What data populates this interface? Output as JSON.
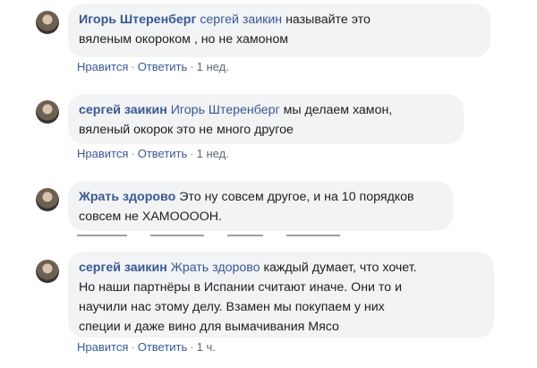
{
  "comments": [
    {
      "author": "Игорь Штеренберг",
      "mention": "сергей заикин",
      "text_line1": "называйте это",
      "text_line2": "вяленым окороком , но не хамоном",
      "like_label": "Нравится",
      "reply_label": "Ответить",
      "time": "1 нед."
    },
    {
      "author": "сергей заикин",
      "mention": "Игорь Штеренберг",
      "text_line1": "мы делаем хамон,",
      "text_line2": "вяленый окорок это не много другое",
      "like_label": "Нравится",
      "reply_label": "Ответить",
      "time": "1 нед."
    },
    {
      "author": "Жрать здорово",
      "text_line1": "Это ну совсем другое, и на 10 порядков",
      "text_line2": "совсем не ХАМООООН."
    },
    {
      "author": "сергей заикин",
      "mention": "Жрать здорово",
      "text_line1": "каждый думает, что хочет.",
      "text_line2": "Но наши партнёры в Испании считают иначе. Они то и",
      "text_line3": "научили нас этому делу. Взамен мы покупаем у них",
      "text_line4": "специи и даже вино для вымачивания Мясо",
      "like_label": "Нравится",
      "reply_label": "Ответить",
      "time": "1 ч."
    }
  ],
  "separator": "·"
}
